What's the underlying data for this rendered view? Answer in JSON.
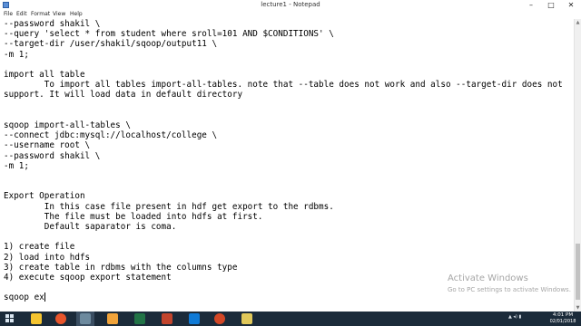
{
  "window": {
    "title": "lecture1 - Notepad",
    "minimize_glyph": "–",
    "maximize_glyph": "□",
    "close_glyph": "✕"
  },
  "menu": [
    "File",
    "Edit",
    "Format",
    "View",
    "Help"
  ],
  "editor": {
    "lines": [
      "--password shakil \\",
      "--query 'select * from student where sroll=101 AND $CONDITIONS' \\",
      "--target-dir /user/shakil/sqoop/output11 \\",
      "-m 1;",
      "",
      "import all table",
      "        To import all tables import-all-tables. note that --table does not work and also --target-dir does not",
      "support. It will load data in default directory",
      "",
      "",
      "sqoop import-all-tables \\",
      "--connect jdbc:mysql://localhost/college \\",
      "--username root \\",
      "--password shakil \\",
      "-m 1;",
      "",
      "",
      "Export Operation",
      "        In this case file present in hdf get export to the rdbms.",
      "        The file must be loaded into hdfs at first.",
      "        Default saparator is coma.",
      "",
      "1) create file",
      "2) load into hdfs",
      "3) create table in rdbms with the columns type",
      "4) execute sqoop export statement",
      "",
      "sqoop ex"
    ]
  },
  "watermark": {
    "line1": "Activate Windows",
    "line2": "Go to PC settings to activate Windows."
  },
  "taskbar": {
    "tray_text": "▲ ◂) ▮",
    "time": "4:01 PM",
    "date": "02/01/2018",
    "icon_colors": [
      "#f4c430",
      "#e8552b",
      "#6d8a9e",
      "#f0a33a",
      "#217346",
      "#c2452d",
      "#0f7ad6",
      "#d24726",
      "#e0c85a"
    ]
  }
}
